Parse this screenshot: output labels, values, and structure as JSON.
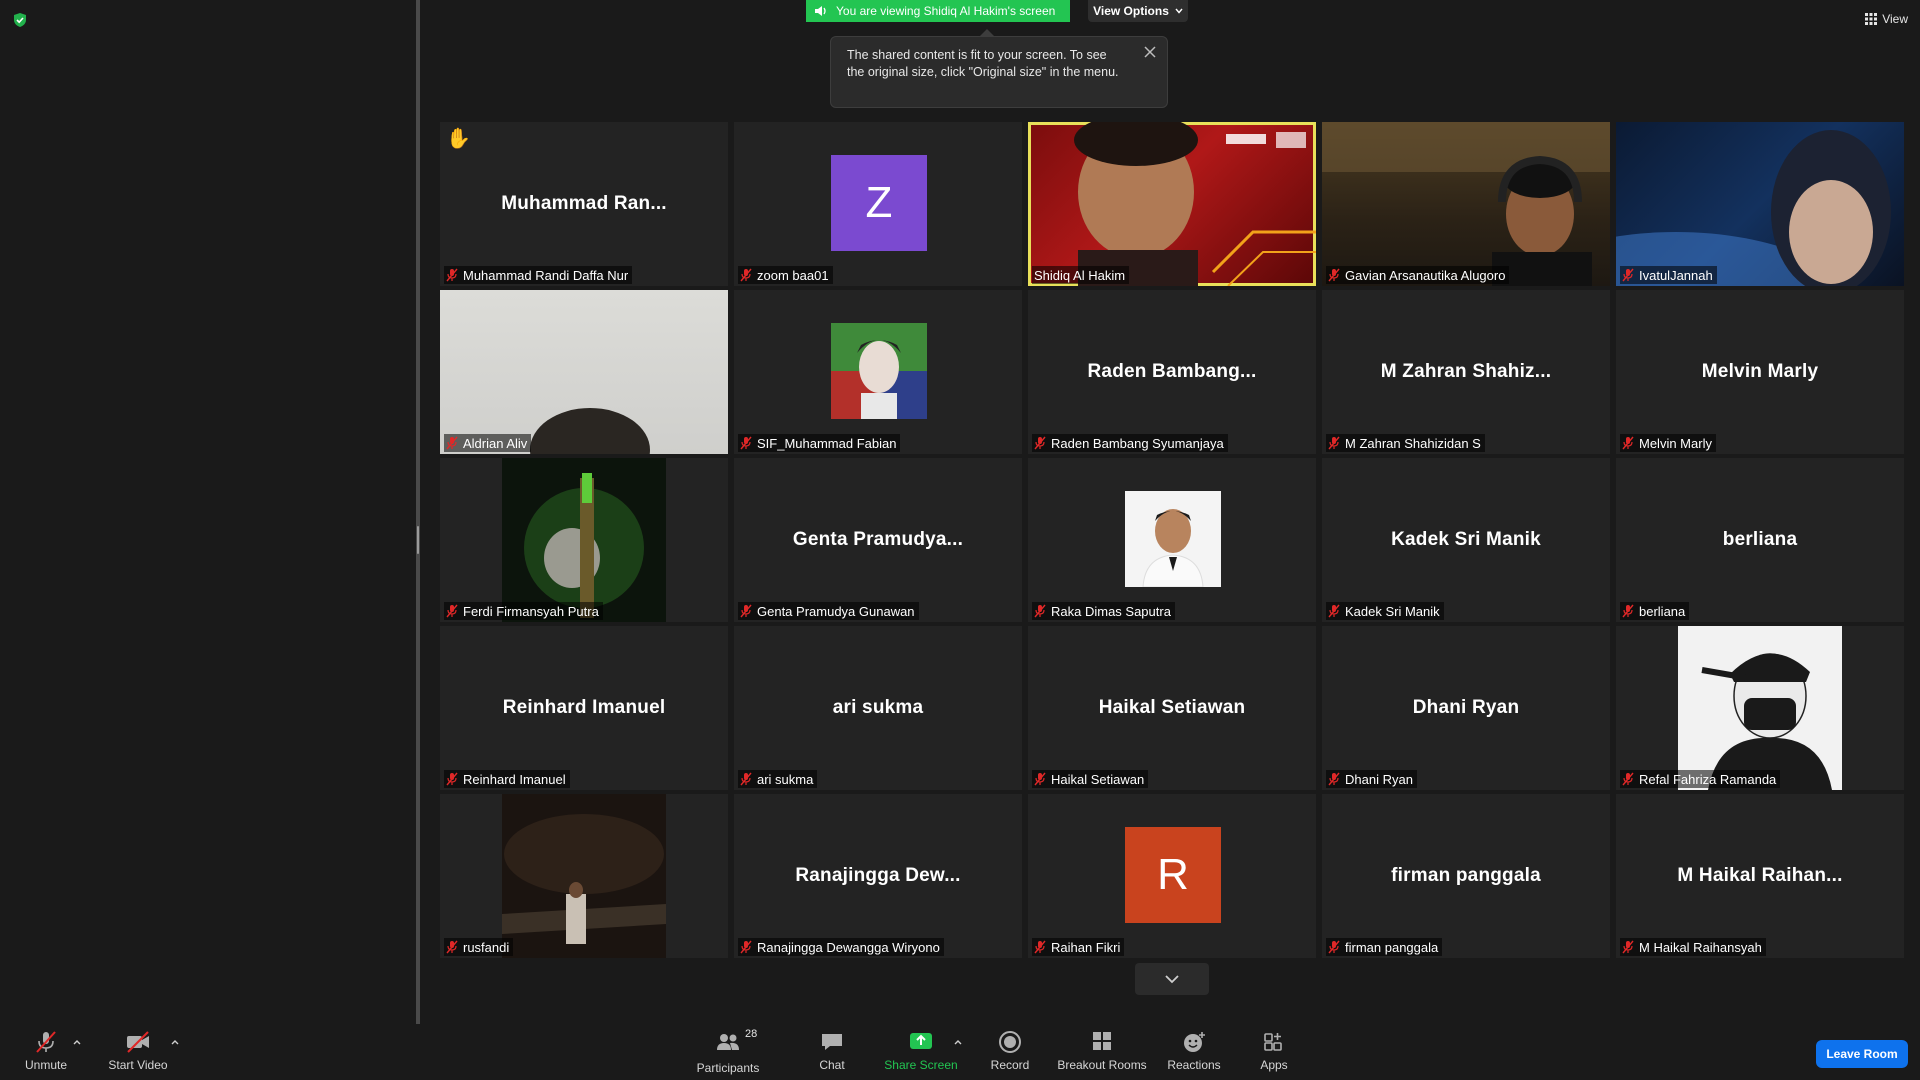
{
  "banner": {
    "viewing_text": "You are viewing Shidiq Al Hakim's screen",
    "view_options_label": "View Options"
  },
  "tooltip": {
    "text": "The shared content is fit to your screen. To see the original size, click \"Original size\" in the menu."
  },
  "view_button": {
    "label": "View"
  },
  "tiles": [
    {
      "center": "Muhammad  Ran...",
      "label": "Muhammad Randi Daffa Nur"
    },
    {
      "center": "",
      "label": "zoom baa01",
      "avatar_letter": "Z"
    },
    {
      "center": "",
      "label": "Shidiq Al Hakim"
    },
    {
      "center": "",
      "label": "Gavian Arsanautika Alugoro"
    },
    {
      "center": "",
      "label": "IvatulJannah"
    },
    {
      "center": "",
      "label": "Aldrian Aliv"
    },
    {
      "center": "",
      "label": "SIF_Muhammad Fabian"
    },
    {
      "center": "Raden  Bambang...",
      "label": "Raden Bambang Syumanjaya"
    },
    {
      "center": "M  Zahran  Shahiz...",
      "label": "M Zahran Shahizidan S"
    },
    {
      "center": "Melvin Marly",
      "label": "Melvin Marly"
    },
    {
      "center": "",
      "label": "Ferdi Firmansyah Putra"
    },
    {
      "center": "Genta  Pramudya...",
      "label": "Genta Pramudya Gunawan"
    },
    {
      "center": "",
      "label": "Raka Dimas Saputra"
    },
    {
      "center": "Kadek Sri Manik",
      "label": "Kadek Sri Manik"
    },
    {
      "center": "berliana",
      "label": "berliana"
    },
    {
      "center": "Reinhard Imanuel",
      "label": "Reinhard Imanuel"
    },
    {
      "center": "ari sukma",
      "label": "ari sukma"
    },
    {
      "center": "Haikal Setiawan",
      "label": "Haikal Setiawan"
    },
    {
      "center": "Dhani Ryan",
      "label": "Dhani Ryan"
    },
    {
      "center": "",
      "label": "Refal Fahriza Ramanda"
    },
    {
      "center": "",
      "label": "rusfandi"
    },
    {
      "center": "Ranajingga  Dew...",
      "label": "Ranajingga Dewangga Wiryono"
    },
    {
      "center": "",
      "label": "Raihan Fikri",
      "avatar_letter": "R"
    },
    {
      "center": "firman panggala",
      "label": "firman panggala"
    },
    {
      "center": "M  Haikal  Raihan...",
      "label": "M Haikal Raihansyah"
    }
  ],
  "toolbar": {
    "unmute": "Unmute",
    "start_video": "Start Video",
    "participants": "Participants",
    "participants_count": "28",
    "chat": "Chat",
    "share_screen": "Share Screen",
    "record": "Record",
    "breakout_rooms": "Breakout Rooms",
    "reactions": "Reactions",
    "apps": "Apps",
    "leave": "Leave Room"
  },
  "colors": {
    "banner_green": "#23c552",
    "leave_blue": "#0e72ed",
    "active_speaker": "#e9e05a",
    "share_green": "#23c552"
  }
}
